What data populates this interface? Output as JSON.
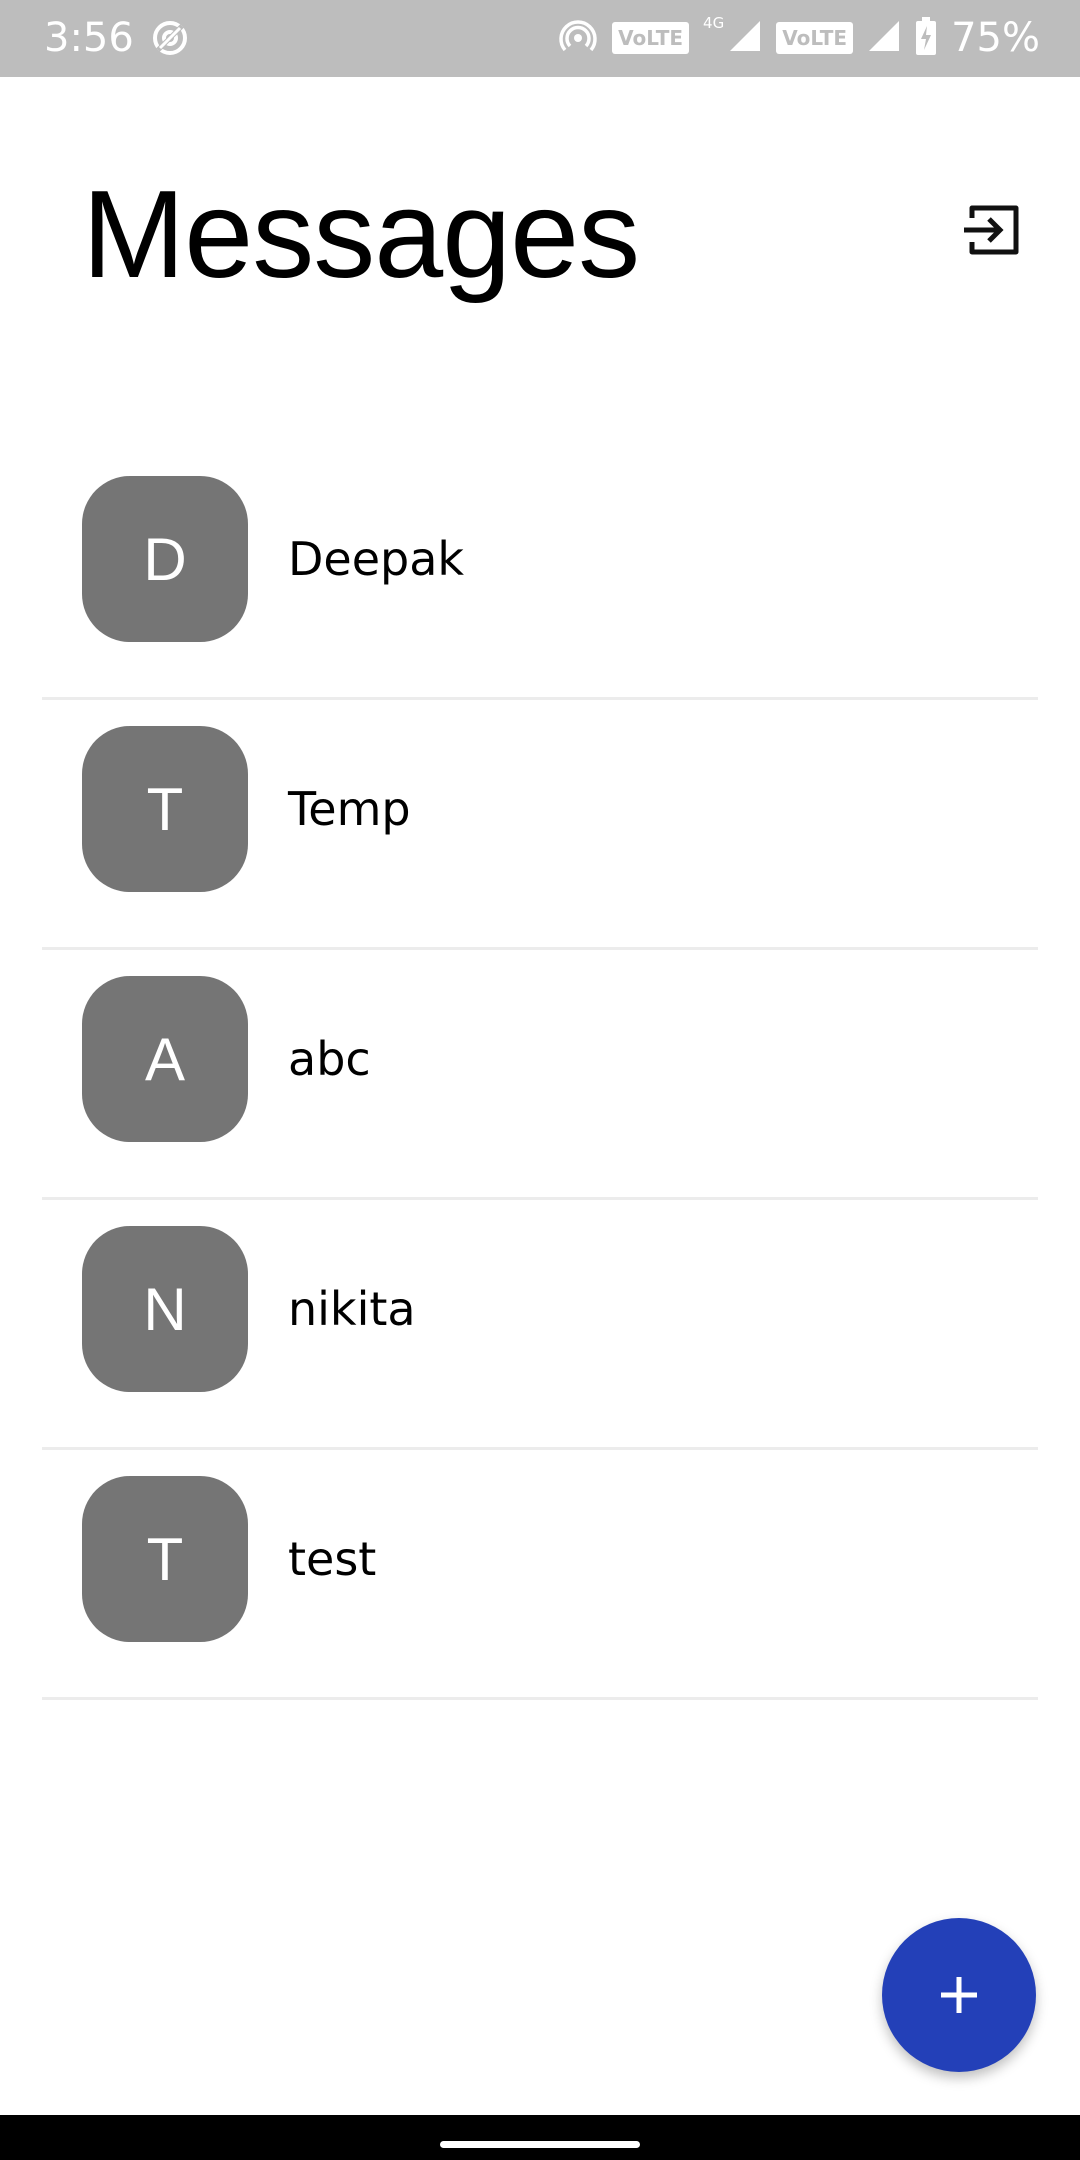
{
  "status_bar": {
    "time": "3:56",
    "net_type": "4G",
    "volte_1": "VoLTE",
    "volte_2": "VoLTE",
    "battery": "75%",
    "icons": [
      "data-saver-icon",
      "hotspot-icon",
      "signal-icon",
      "battery-charging-icon"
    ]
  },
  "header": {
    "title": "Messages",
    "logout_icon": "logout-icon"
  },
  "conversations": [
    {
      "initial": "D",
      "name": "Deepak"
    },
    {
      "initial": "T",
      "name": "Temp"
    },
    {
      "initial": "A",
      "name": "abc"
    },
    {
      "initial": "N",
      "name": "nikita"
    },
    {
      "initial": "T",
      "name": "test"
    }
  ],
  "fab": {
    "icon": "plus-icon",
    "color": "#2340b8"
  },
  "colors": {
    "avatar_bg": "#757575",
    "status_bar_bg": "#bdbdbd"
  }
}
